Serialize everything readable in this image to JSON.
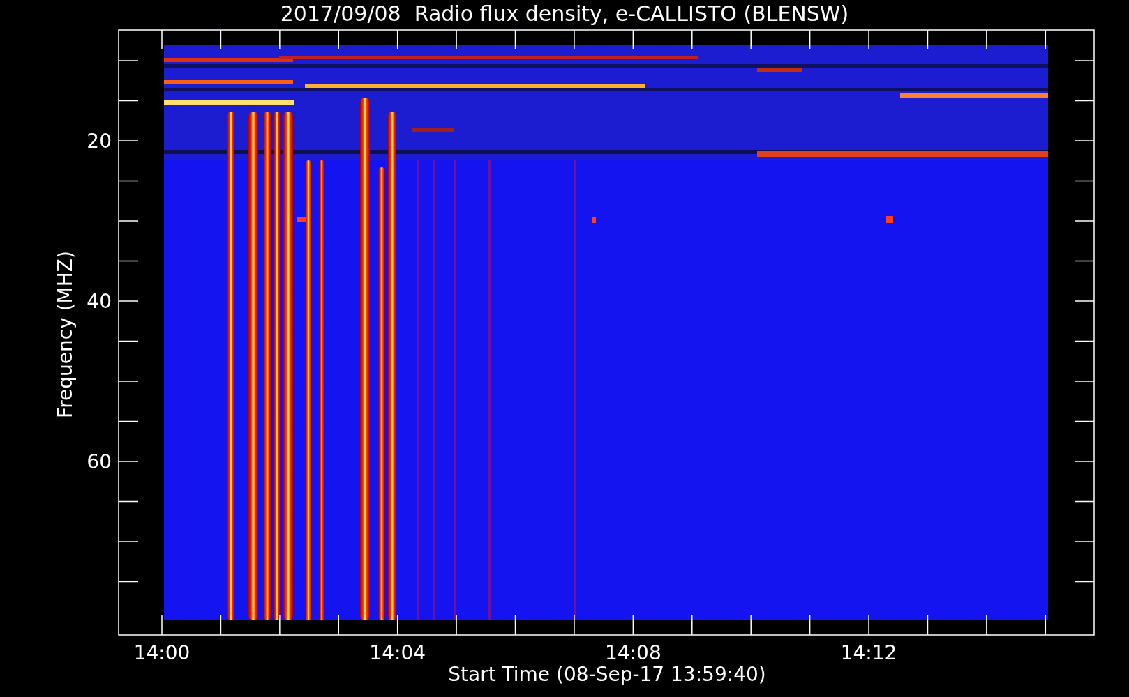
{
  "title": "2017/09/08  Radio flux density, e-CALLISTO (BLENSW)",
  "ylabel": "Frequency (MHZ)",
  "xlabel": "Start Time (08-Sep-17 13:59:40)",
  "yticks": [
    "20",
    "40",
    "60"
  ],
  "xticks": [
    "14:00",
    "14:04",
    "14:08",
    "14:12"
  ]
}
